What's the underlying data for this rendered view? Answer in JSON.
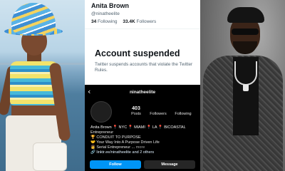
{
  "twitter": {
    "display_name": "Anita Brown",
    "handle": "@ninatheelite",
    "following_count": "34",
    "following_label": "Following",
    "followers_count": "33.4K",
    "followers_label": "Followers",
    "suspended_title": "Account suspended",
    "suspended_description": "Twitter suspends accounts that violate the Twitter Rules."
  },
  "instagram": {
    "back_icon": "back-arrow-icon",
    "username": "ninatheelite",
    "posts_count": "403",
    "posts_label": "Posts",
    "followers_label": "Followers",
    "following_label": "Following",
    "bio": {
      "name_line": "Anita Brown 📍 NYC 📍 MIAMI 📍 LA 📍 BICOASTAL",
      "line1": "Entrepreneur",
      "line2": "🏆 CONDUIT TO PURPOSE",
      "line3": "🤝 Your Way Into A Purpose Driven Life",
      "line4": "👩 Serial Entrepreneur ...",
      "more": "more"
    },
    "link_text": "🔗 linktr.ee/ninatheelite and 2 others",
    "follow_label": "Follow",
    "message_label": "Message",
    "colors": {
      "follow_button": "#0095f6",
      "message_button": "#262626",
      "background": "#000000"
    }
  }
}
